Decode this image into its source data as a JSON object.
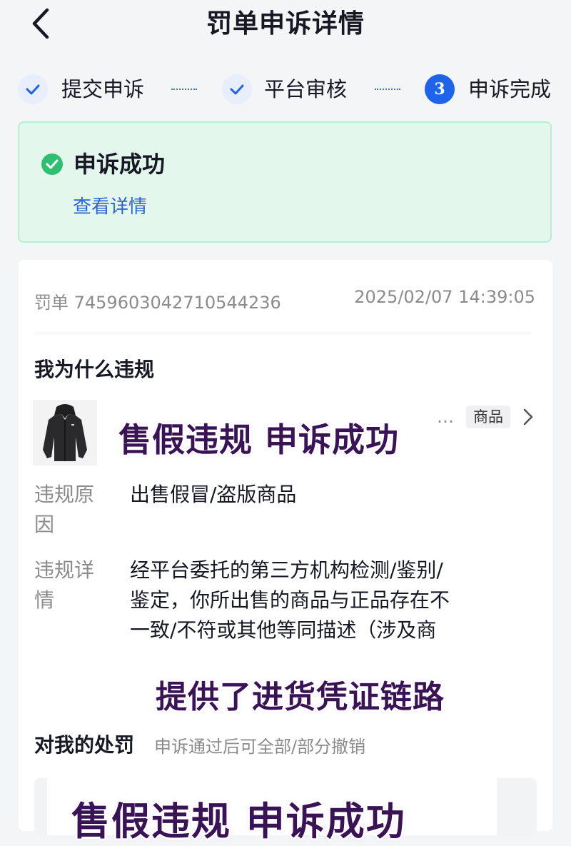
{
  "header": {
    "title": "罚单申诉详情",
    "back_icon": "chevron-left-icon"
  },
  "steps": [
    {
      "label": "提交申诉",
      "status": "done"
    },
    {
      "label": "平台审核",
      "status": "done"
    },
    {
      "label": "申诉完成",
      "status": "current",
      "number": "3"
    }
  ],
  "result": {
    "title": "申诉成功",
    "link": "查看详情",
    "status_color": "#2fbf71"
  },
  "ticket": {
    "id_label": "罚单 745960304271054423​6",
    "datetime": "2025/02/07 14:39:05"
  },
  "violation": {
    "section_title": "我为什么违规",
    "tag": "商品",
    "ellipsis": "…",
    "reason_label_lines": [
      "违规原",
      "因"
    ],
    "reason_value": "出售假冒/盗版商品",
    "detail_label_lines": [
      "违规详",
      "情"
    ],
    "detail_value_lines": [
      "经平台委托的第三方机构检测/鉴别/",
      "鉴定，你所出售的商品与正品存在不",
      "一致/不符或其他等同描述（涉及商"
    ]
  },
  "penalty": {
    "section_title": "对我的处罚",
    "subtitle": "申诉通过后可全部/部分撤销"
  },
  "overlays": {
    "banner_top": "售假违规  申诉成功",
    "banner_mid": "提供了进货凭证链路",
    "banner_bottom": "售假违规  申诉成功"
  },
  "colors": {
    "accent": "#1e63e9",
    "link": "#2a64d8",
    "success_bg": "#e3f7ec"
  }
}
